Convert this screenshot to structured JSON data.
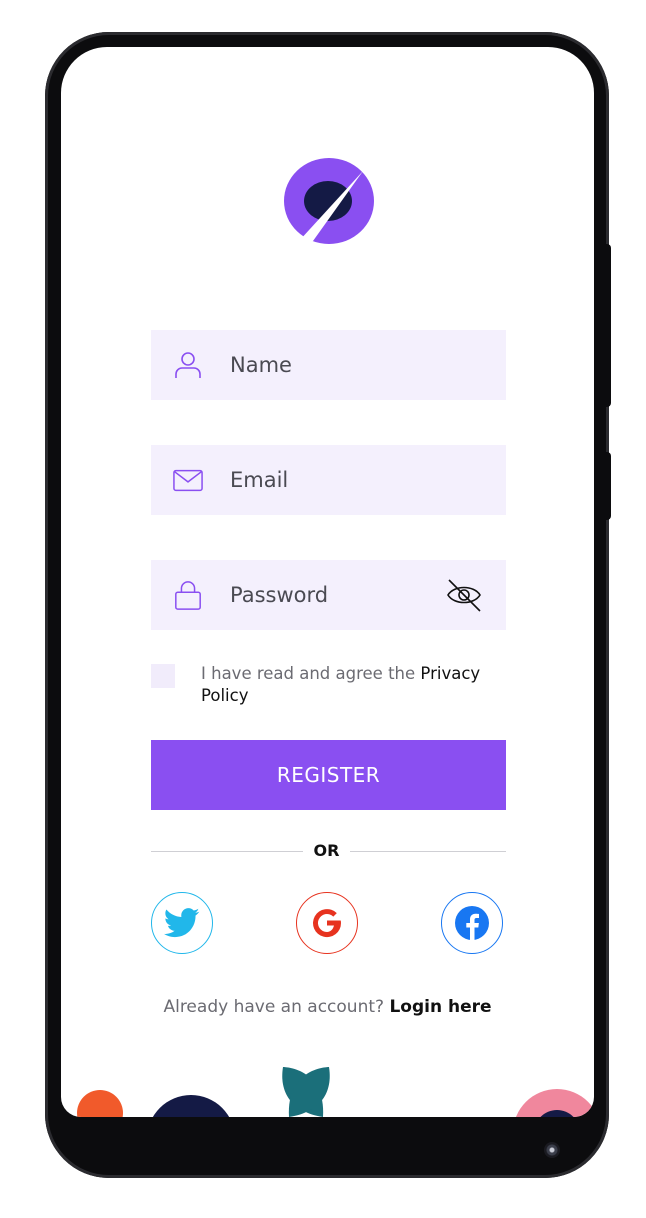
{
  "form": {
    "name_placeholder": "Name",
    "email_placeholder": "Email",
    "password_placeholder": "Password"
  },
  "agreement": {
    "text": "I have read and agree the ",
    "link": "Privacy Policy"
  },
  "register_label": "REGISTER",
  "divider_label": "OR",
  "social": [
    "twitter-icon",
    "google-icon",
    "facebook-icon"
  ],
  "footer": {
    "prompt": "Already have an account? ",
    "login_label": "Login here"
  },
  "colors": {
    "accent": "#8a4ff1",
    "field_bg": "#f4f0fd",
    "twitter": "#21b7ea",
    "google": "#e7331f",
    "facebook": "#1877f2"
  }
}
